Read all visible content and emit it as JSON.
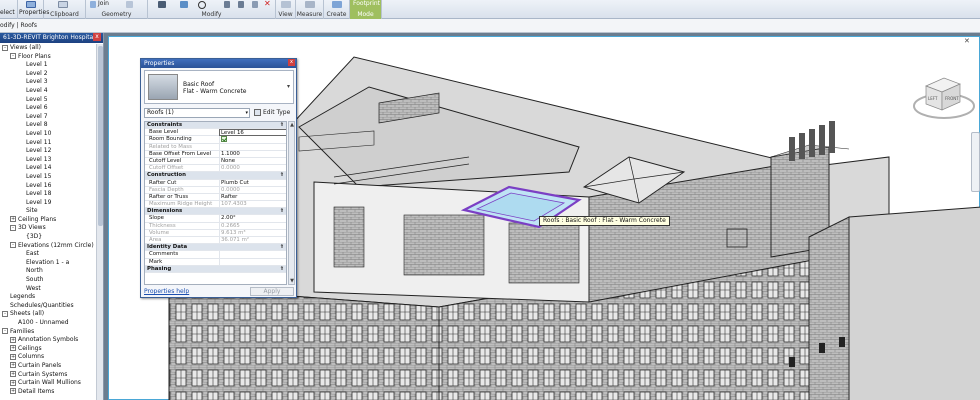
{
  "ribbon": {
    "groups": [
      {
        "label": "",
        "items": [
          "elect"
        ]
      },
      {
        "label": "",
        "items": [
          "Properties"
        ]
      },
      {
        "label": "Clipboard",
        "items": []
      },
      {
        "label": "Geometry",
        "items": [
          "Join"
        ]
      },
      {
        "label": "Modify",
        "items": []
      },
      {
        "label": "View",
        "items": []
      },
      {
        "label": "Measure",
        "items": []
      },
      {
        "label": "Create",
        "items": []
      },
      {
        "label": "Mode",
        "items": [
          "Footprint"
        ]
      }
    ]
  },
  "context_bar": {
    "modify_label": "odify | Roofs"
  },
  "project_browser": {
    "title": "61-3D-REVIT Brighton Hospita...",
    "close": "x",
    "items": [
      {
        "label": "Views (all)",
        "level": 0,
        "toggle": "-"
      },
      {
        "label": "Floor Plans",
        "level": 1,
        "toggle": "-"
      },
      {
        "label": "Level 1",
        "level": 2,
        "toggle": ""
      },
      {
        "label": "Level 2",
        "level": 2,
        "toggle": ""
      },
      {
        "label": "Level 3",
        "level": 2,
        "toggle": ""
      },
      {
        "label": "Level 4",
        "level": 2,
        "toggle": ""
      },
      {
        "label": "Level 5",
        "level": 2,
        "toggle": ""
      },
      {
        "label": "Level 6",
        "level": 2,
        "toggle": ""
      },
      {
        "label": "Level 7",
        "level": 2,
        "toggle": ""
      },
      {
        "label": "Level 8",
        "level": 2,
        "toggle": ""
      },
      {
        "label": "Level 10",
        "level": 2,
        "toggle": ""
      },
      {
        "label": "Level 11",
        "level": 2,
        "toggle": ""
      },
      {
        "label": "Level 12",
        "level": 2,
        "toggle": ""
      },
      {
        "label": "Level 13",
        "level": 2,
        "toggle": ""
      },
      {
        "label": "Level 14",
        "level": 2,
        "toggle": ""
      },
      {
        "label": "Level 15",
        "level": 2,
        "toggle": ""
      },
      {
        "label": "Level 16",
        "level": 2,
        "toggle": ""
      },
      {
        "label": "Level 18",
        "level": 2,
        "toggle": ""
      },
      {
        "label": "Level 19",
        "level": 2,
        "toggle": ""
      },
      {
        "label": "Site",
        "level": 2,
        "toggle": ""
      },
      {
        "label": "Ceiling Plans",
        "level": 1,
        "toggle": "+"
      },
      {
        "label": "3D Views",
        "level": 1,
        "toggle": "-"
      },
      {
        "label": "{3D}",
        "level": 2,
        "toggle": ""
      },
      {
        "label": "Elevations (12mm Circle)",
        "level": 1,
        "toggle": "-"
      },
      {
        "label": "East",
        "level": 2,
        "toggle": ""
      },
      {
        "label": "Elevation 1 - a",
        "level": 2,
        "toggle": ""
      },
      {
        "label": "North",
        "level": 2,
        "toggle": ""
      },
      {
        "label": "South",
        "level": 2,
        "toggle": ""
      },
      {
        "label": "West",
        "level": 2,
        "toggle": ""
      },
      {
        "label": "Legends",
        "level": 0,
        "toggle": ""
      },
      {
        "label": "Schedules/Quantities",
        "level": 0,
        "toggle": ""
      },
      {
        "label": "Sheets (all)",
        "level": 0,
        "toggle": "-"
      },
      {
        "label": "A100 - Unnamed",
        "level": 1,
        "toggle": ""
      },
      {
        "label": "Families",
        "level": 0,
        "toggle": "-"
      },
      {
        "label": "Annotation Symbols",
        "level": 1,
        "toggle": "+"
      },
      {
        "label": "Ceilings",
        "level": 1,
        "toggle": "+"
      },
      {
        "label": "Columns",
        "level": 1,
        "toggle": "+"
      },
      {
        "label": "Curtain Panels",
        "level": 1,
        "toggle": "+"
      },
      {
        "label": "Curtain Systems",
        "level": 1,
        "toggle": "+"
      },
      {
        "label": "Curtain Wall Mullions",
        "level": 1,
        "toggle": "+"
      },
      {
        "label": "Detail Items",
        "level": 1,
        "toggle": "+"
      }
    ]
  },
  "properties": {
    "title": "Properties",
    "close": "x",
    "type_line1": "Basic Roof",
    "type_line2": "Flat - Warm Concrete",
    "instance_selector": "Roofs (1)",
    "edit_type": "Edit Type",
    "rows": [
      {
        "kind": "group",
        "key": "Constraints"
      },
      {
        "kind": "prop",
        "key": "Base Level",
        "value": "Level 16",
        "edit": true
      },
      {
        "kind": "prop",
        "key": "Room Bounding",
        "value": "",
        "check": true
      },
      {
        "kind": "prop",
        "key": "Related to Mass",
        "value": "",
        "dim": true
      },
      {
        "kind": "prop",
        "key": "Base Offset From Level",
        "value": "1.1000"
      },
      {
        "kind": "prop",
        "key": "Cutoff Level",
        "value": "None"
      },
      {
        "kind": "prop",
        "key": "Cutoff Offset",
        "value": "0.0000",
        "dim": true
      },
      {
        "kind": "group",
        "key": "Construction"
      },
      {
        "kind": "prop",
        "key": "Rafter Cut",
        "value": "Plumb Cut"
      },
      {
        "kind": "prop",
        "key": "Fascia Depth",
        "value": "0.0000",
        "dim": true
      },
      {
        "kind": "prop",
        "key": "Rafter or Truss",
        "value": "Rafter"
      },
      {
        "kind": "prop",
        "key": "Maximum Ridge Height",
        "value": "107.4303",
        "dim": true
      },
      {
        "kind": "group",
        "key": "Dimensions"
      },
      {
        "kind": "prop",
        "key": "Slope",
        "value": "2.00°"
      },
      {
        "kind": "prop",
        "key": "Thickness",
        "value": "0.2665",
        "dim": true
      },
      {
        "kind": "prop",
        "key": "Volume",
        "value": "9.613 m³",
        "dim": true
      },
      {
        "kind": "prop",
        "key": "Area",
        "value": "36.071 m²",
        "dim": true
      },
      {
        "kind": "group",
        "key": "Identity Data"
      },
      {
        "kind": "prop",
        "key": "Comments",
        "value": ""
      },
      {
        "kind": "prop",
        "key": "Mark",
        "value": ""
      },
      {
        "kind": "group",
        "key": "Phasing"
      }
    ],
    "help_link": "Properties help",
    "apply": "Apply"
  },
  "tooltip": "Roofs : Basic Roof : Flat - Warm Concrete",
  "viewcube": {
    "face_left": "LEFT",
    "face_front": "FRONT"
  },
  "colors": {
    "selection": "#7b3fc4",
    "viewport_border": "#4aa7d6",
    "mode_group": "#9fbf5f"
  }
}
